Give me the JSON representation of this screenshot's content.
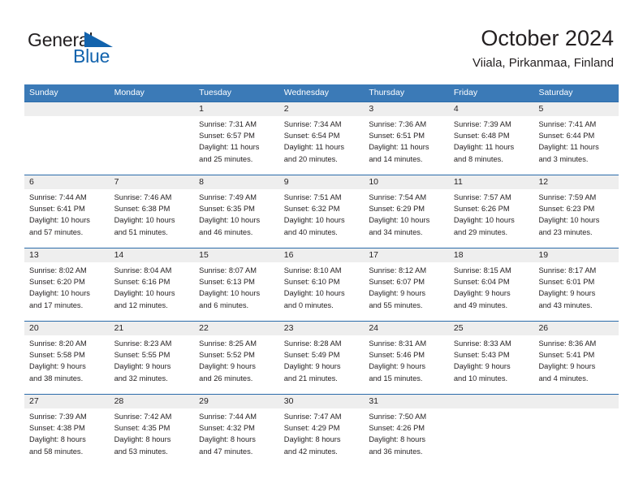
{
  "brand": {
    "word_one": "General",
    "word_two": "Blue",
    "triangle_color": "#1263ad"
  },
  "header": {
    "title": "October 2024",
    "subtitle": "Viiala, Pirkanmaa, Finland"
  },
  "theme": {
    "header_blue": "#3b7ab7",
    "rule_blue": "#2b6caa",
    "date_band_gray": "#eeeeee",
    "text": "#231f20"
  },
  "calendar": {
    "weekdays": [
      "Sunday",
      "Monday",
      "Tuesday",
      "Wednesday",
      "Thursday",
      "Friday",
      "Saturday"
    ],
    "weeks": [
      {
        "days": [
          {
            "date": "",
            "lines": []
          },
          {
            "date": "",
            "lines": []
          },
          {
            "date": "1",
            "lines": [
              "Sunrise: 7:31 AM",
              "Sunset: 6:57 PM",
              "Daylight: 11 hours",
              "and 25 minutes."
            ]
          },
          {
            "date": "2",
            "lines": [
              "Sunrise: 7:34 AM",
              "Sunset: 6:54 PM",
              "Daylight: 11 hours",
              "and 20 minutes."
            ]
          },
          {
            "date": "3",
            "lines": [
              "Sunrise: 7:36 AM",
              "Sunset: 6:51 PM",
              "Daylight: 11 hours",
              "and 14 minutes."
            ]
          },
          {
            "date": "4",
            "lines": [
              "Sunrise: 7:39 AM",
              "Sunset: 6:48 PM",
              "Daylight: 11 hours",
              "and 8 minutes."
            ]
          },
          {
            "date": "5",
            "lines": [
              "Sunrise: 7:41 AM",
              "Sunset: 6:44 PM",
              "Daylight: 11 hours",
              "and 3 minutes."
            ]
          }
        ]
      },
      {
        "days": [
          {
            "date": "6",
            "lines": [
              "Sunrise: 7:44 AM",
              "Sunset: 6:41 PM",
              "Daylight: 10 hours",
              "and 57 minutes."
            ]
          },
          {
            "date": "7",
            "lines": [
              "Sunrise: 7:46 AM",
              "Sunset: 6:38 PM",
              "Daylight: 10 hours",
              "and 51 minutes."
            ]
          },
          {
            "date": "8",
            "lines": [
              "Sunrise: 7:49 AM",
              "Sunset: 6:35 PM",
              "Daylight: 10 hours",
              "and 46 minutes."
            ]
          },
          {
            "date": "9",
            "lines": [
              "Sunrise: 7:51 AM",
              "Sunset: 6:32 PM",
              "Daylight: 10 hours",
              "and 40 minutes."
            ]
          },
          {
            "date": "10",
            "lines": [
              "Sunrise: 7:54 AM",
              "Sunset: 6:29 PM",
              "Daylight: 10 hours",
              "and 34 minutes."
            ]
          },
          {
            "date": "11",
            "lines": [
              "Sunrise: 7:57 AM",
              "Sunset: 6:26 PM",
              "Daylight: 10 hours",
              "and 29 minutes."
            ]
          },
          {
            "date": "12",
            "lines": [
              "Sunrise: 7:59 AM",
              "Sunset: 6:23 PM",
              "Daylight: 10 hours",
              "and 23 minutes."
            ]
          }
        ]
      },
      {
        "days": [
          {
            "date": "13",
            "lines": [
              "Sunrise: 8:02 AM",
              "Sunset: 6:20 PM",
              "Daylight: 10 hours",
              "and 17 minutes."
            ]
          },
          {
            "date": "14",
            "lines": [
              "Sunrise: 8:04 AM",
              "Sunset: 6:16 PM",
              "Daylight: 10 hours",
              "and 12 minutes."
            ]
          },
          {
            "date": "15",
            "lines": [
              "Sunrise: 8:07 AM",
              "Sunset: 6:13 PM",
              "Daylight: 10 hours",
              "and 6 minutes."
            ]
          },
          {
            "date": "16",
            "lines": [
              "Sunrise: 8:10 AM",
              "Sunset: 6:10 PM",
              "Daylight: 10 hours",
              "and 0 minutes."
            ]
          },
          {
            "date": "17",
            "lines": [
              "Sunrise: 8:12 AM",
              "Sunset: 6:07 PM",
              "Daylight: 9 hours",
              "and 55 minutes."
            ]
          },
          {
            "date": "18",
            "lines": [
              "Sunrise: 8:15 AM",
              "Sunset: 6:04 PM",
              "Daylight: 9 hours",
              "and 49 minutes."
            ]
          },
          {
            "date": "19",
            "lines": [
              "Sunrise: 8:17 AM",
              "Sunset: 6:01 PM",
              "Daylight: 9 hours",
              "and 43 minutes."
            ]
          }
        ]
      },
      {
        "days": [
          {
            "date": "20",
            "lines": [
              "Sunrise: 8:20 AM",
              "Sunset: 5:58 PM",
              "Daylight: 9 hours",
              "and 38 minutes."
            ]
          },
          {
            "date": "21",
            "lines": [
              "Sunrise: 8:23 AM",
              "Sunset: 5:55 PM",
              "Daylight: 9 hours",
              "and 32 minutes."
            ]
          },
          {
            "date": "22",
            "lines": [
              "Sunrise: 8:25 AM",
              "Sunset: 5:52 PM",
              "Daylight: 9 hours",
              "and 26 minutes."
            ]
          },
          {
            "date": "23",
            "lines": [
              "Sunrise: 8:28 AM",
              "Sunset: 5:49 PM",
              "Daylight: 9 hours",
              "and 21 minutes."
            ]
          },
          {
            "date": "24",
            "lines": [
              "Sunrise: 8:31 AM",
              "Sunset: 5:46 PM",
              "Daylight: 9 hours",
              "and 15 minutes."
            ]
          },
          {
            "date": "25",
            "lines": [
              "Sunrise: 8:33 AM",
              "Sunset: 5:43 PM",
              "Daylight: 9 hours",
              "and 10 minutes."
            ]
          },
          {
            "date": "26",
            "lines": [
              "Sunrise: 8:36 AM",
              "Sunset: 5:41 PM",
              "Daylight: 9 hours",
              "and 4 minutes."
            ]
          }
        ]
      },
      {
        "days": [
          {
            "date": "27",
            "lines": [
              "Sunrise: 7:39 AM",
              "Sunset: 4:38 PM",
              "Daylight: 8 hours",
              "and 58 minutes."
            ]
          },
          {
            "date": "28",
            "lines": [
              "Sunrise: 7:42 AM",
              "Sunset: 4:35 PM",
              "Daylight: 8 hours",
              "and 53 minutes."
            ]
          },
          {
            "date": "29",
            "lines": [
              "Sunrise: 7:44 AM",
              "Sunset: 4:32 PM",
              "Daylight: 8 hours",
              "and 47 minutes."
            ]
          },
          {
            "date": "30",
            "lines": [
              "Sunrise: 7:47 AM",
              "Sunset: 4:29 PM",
              "Daylight: 8 hours",
              "and 42 minutes."
            ]
          },
          {
            "date": "31",
            "lines": [
              "Sunrise: 7:50 AM",
              "Sunset: 4:26 PM",
              "Daylight: 8 hours",
              "and 36 minutes."
            ]
          },
          {
            "date": "",
            "lines": []
          },
          {
            "date": "",
            "lines": []
          }
        ]
      }
    ]
  }
}
